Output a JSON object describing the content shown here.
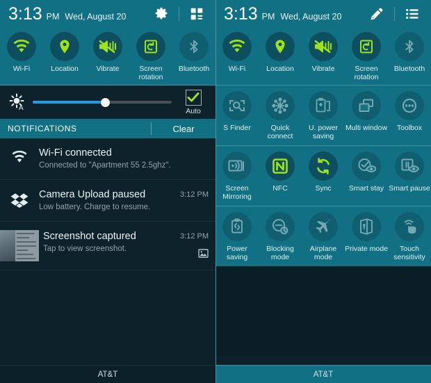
{
  "colors": {
    "teal_panel": "#127085",
    "dark_panel": "#0d222b",
    "accent_green": "#9ee21a",
    "slider_blue": "#1c9fe8",
    "inactive_icon": "#6fa3ae"
  },
  "left_panel": {
    "status_bar": {
      "time": "3:13",
      "ampm": "PM",
      "date": "Wed, August 20",
      "icons": [
        {
          "name": "gear-icon",
          "label": "Settings"
        },
        {
          "name": "quick-settings-grid-icon",
          "label": "Quick settings"
        }
      ]
    },
    "toggles": [
      {
        "label": "Wi-Fi",
        "icon": "wifi-icon",
        "active": true
      },
      {
        "label": "Location",
        "icon": "location-pin-icon",
        "active": true
      },
      {
        "label": "Vibrate",
        "icon": "vibrate-icon",
        "active": true
      },
      {
        "label": "Screen rotation",
        "icon": "screen-rotation-icon",
        "active": true
      },
      {
        "label": "Bluetooth",
        "icon": "bluetooth-icon",
        "active": false
      }
    ],
    "brightness": {
      "icon": "brightness-auto-icon",
      "value_percent": 52,
      "auto_label": "Auto",
      "auto_checked": true
    },
    "notifications_header": {
      "title": "NOTIFICATIONS",
      "clear_label": "Clear"
    },
    "notifications": [
      {
        "icon": "wifi-icon",
        "title": "Wi-Fi connected",
        "subtitle": "Connected to \"Apartment 55 2.5ghz\".",
        "time": ""
      },
      {
        "icon": "dropbox-icon",
        "title": "Camera Upload paused",
        "subtitle": "Low battery. Charge to resume.",
        "time": "3:12 PM"
      },
      {
        "icon": "screenshot-thumbnail",
        "title": "Screenshot captured",
        "subtitle": "Tap to view screenshot.",
        "time": "3:12 PM",
        "action_icon": "image-icon"
      }
    ],
    "carrier": "AT&T"
  },
  "right_panel": {
    "status_bar": {
      "time": "3:13",
      "ampm": "PM",
      "date": "Wed, August 20",
      "icons": [
        {
          "name": "edit-pencil-icon",
          "label": "Edit"
        },
        {
          "name": "list-icon",
          "label": "List view"
        }
      ]
    },
    "toggles": [
      {
        "label": "Wi-Fi",
        "icon": "wifi-icon",
        "active": true
      },
      {
        "label": "Location",
        "icon": "location-pin-icon",
        "active": true
      },
      {
        "label": "Vibrate",
        "icon": "vibrate-icon",
        "active": true
      },
      {
        "label": "Screen rotation",
        "icon": "screen-rotation-icon",
        "active": true
      },
      {
        "label": "Bluetooth",
        "icon": "bluetooth-icon",
        "active": false
      }
    ],
    "grid_rows": [
      [
        {
          "label": "S Finder",
          "icon": "s-finder-icon",
          "active": false
        },
        {
          "label": "Quick connect",
          "icon": "quick-connect-icon",
          "active": false
        },
        {
          "label": "U. power saving",
          "icon": "ultra-power-saving-icon",
          "active": false
        },
        {
          "label": "Multi window",
          "icon": "multi-window-icon",
          "active": false
        },
        {
          "label": "Toolbox",
          "icon": "toolbox-icon",
          "active": false
        }
      ],
      [
        {
          "label": "Screen Mirroring",
          "icon": "screen-mirroring-icon",
          "active": false
        },
        {
          "label": "NFC",
          "icon": "nfc-icon",
          "active": true
        },
        {
          "label": "Sync",
          "icon": "sync-icon",
          "active": true
        },
        {
          "label": "Smart stay",
          "icon": "smart-stay-icon",
          "active": false
        },
        {
          "label": "Smart pause",
          "icon": "smart-pause-icon",
          "active": false
        }
      ],
      [
        {
          "label": "Power saving",
          "icon": "power-saving-icon",
          "active": false
        },
        {
          "label": "Blocking mode",
          "icon": "blocking-mode-icon",
          "active": false
        },
        {
          "label": "Airplane mode",
          "icon": "airplane-mode-icon",
          "active": false
        },
        {
          "label": "Private mode",
          "icon": "private-mode-icon",
          "active": false
        },
        {
          "label": "Touch sensitivity",
          "icon": "touch-sensitivity-icon",
          "active": false
        }
      ]
    ],
    "carrier": "AT&T"
  }
}
